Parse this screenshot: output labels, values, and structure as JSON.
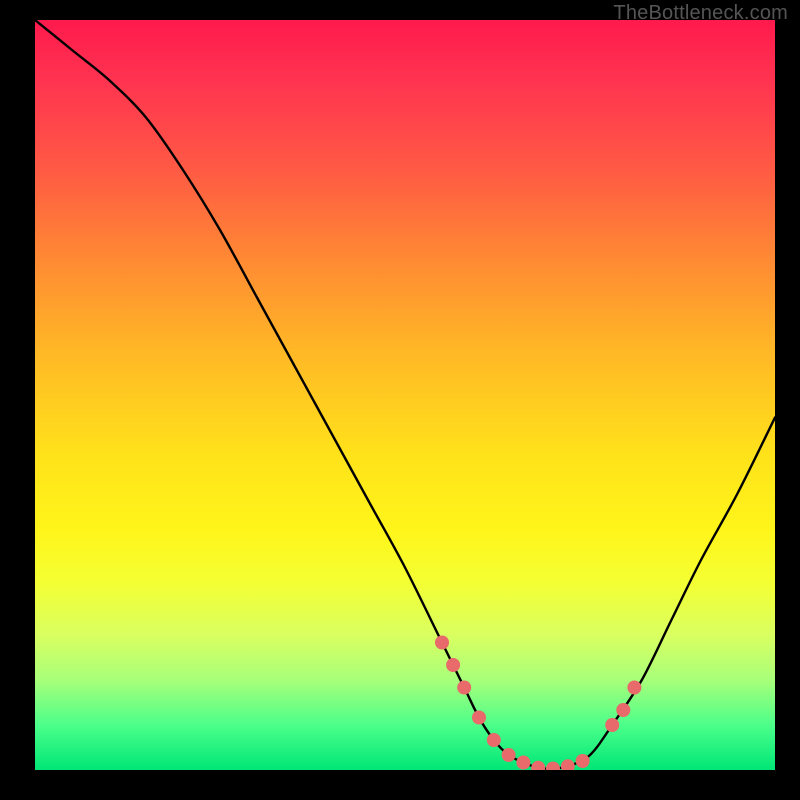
{
  "watermark": "TheBottleneck.com",
  "colors": {
    "frame_bg": "#000000",
    "curve_stroke": "#000000",
    "marker_fill": "#e86a6a",
    "marker_stroke": "#c94d4d"
  },
  "chart_data": {
    "type": "line",
    "title": "",
    "xlabel": "",
    "ylabel": "",
    "xlim": [
      0,
      100
    ],
    "ylim": [
      0,
      100
    ],
    "series": [
      {
        "name": "bottleneck-curve",
        "x": [
          0,
          5,
          10,
          15,
          20,
          25,
          30,
          35,
          40,
          45,
          50,
          55,
          58,
          60,
          62,
          64,
          66,
          68,
          70,
          72,
          75,
          78,
          82,
          86,
          90,
          95,
          100
        ],
        "values": [
          100,
          96,
          92,
          87,
          80,
          72,
          63,
          54,
          45,
          36,
          27,
          17,
          11,
          7,
          4,
          2,
          1,
          0.3,
          0.2,
          0.5,
          2,
          6,
          12,
          20,
          28,
          37,
          47
        ]
      }
    ],
    "markers": {
      "name": "highlight-points",
      "x": [
        55,
        56.5,
        58,
        60,
        62,
        64,
        66,
        68,
        70,
        72,
        74,
        78,
        79.5,
        81
      ],
      "values": [
        17,
        14,
        11,
        7,
        4,
        2,
        1,
        0.3,
        0.2,
        0.5,
        1.2,
        6,
        8,
        11
      ]
    }
  }
}
